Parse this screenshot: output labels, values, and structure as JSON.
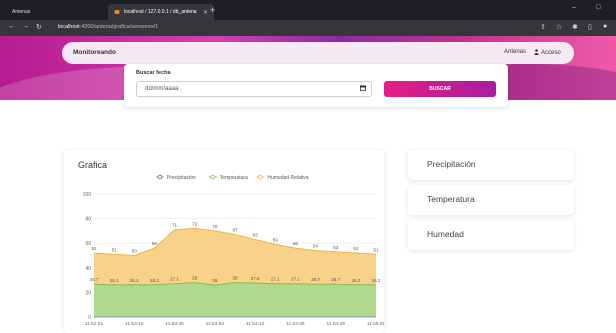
{
  "browser": {
    "tabs": [
      {
        "label": "Antenas"
      },
      {
        "label": "localhost / 127.0.0.1 / db_antena"
      }
    ],
    "url_host": "localhost",
    "url_path": ":4200/antena/grafica/sensores/1"
  },
  "nav": {
    "brand": "Monitoreando",
    "links": [
      "Antenas",
      "Acceso"
    ]
  },
  "search": {
    "label": "Buscar fecha",
    "placeholder": "dd/mm/aaaa",
    "button": "BUSCAR"
  },
  "chart_card": {
    "title": "Grafica"
  },
  "side_cards": [
    "Precipitación",
    "Temperatura",
    "Humedad"
  ],
  "colors": {
    "accent": "#e51f84",
    "precip": "#aeb4d8",
    "temp": "#a7d98e",
    "humidity": "#f8cc7c"
  },
  "chart_data": {
    "type": "area",
    "x": [
      "11:52:51",
      "11:53:10",
      "11:53:30",
      "11:53:50",
      "11:54:10",
      "11:54:29",
      "11:54:49",
      "11:55:09"
    ],
    "series": [
      {
        "name": "Precipitación",
        "values": [
          0,
          0,
          0,
          0,
          0,
          0,
          0,
          0,
          0,
          0,
          0,
          0,
          0,
          0,
          0
        ]
      },
      {
        "name": "Temperatura",
        "values": [
          26.7,
          26.1,
          26.2,
          26.2,
          27.1,
          28,
          26,
          28,
          27.6,
          27.1,
          27.1,
          26.7,
          26.7,
          26.2,
          26.2
        ]
      },
      {
        "name": "Humedad Relativa",
        "values": [
          52,
          51,
          50,
          56,
          71,
          72,
          70,
          67,
          63,
          59,
          56,
          54,
          53,
          52,
          51
        ]
      }
    ],
    "ylim": [
      0,
      100
    ],
    "yticks": [
      0,
      20,
      40,
      60,
      80,
      100
    ],
    "legend": "top",
    "grid": true
  }
}
